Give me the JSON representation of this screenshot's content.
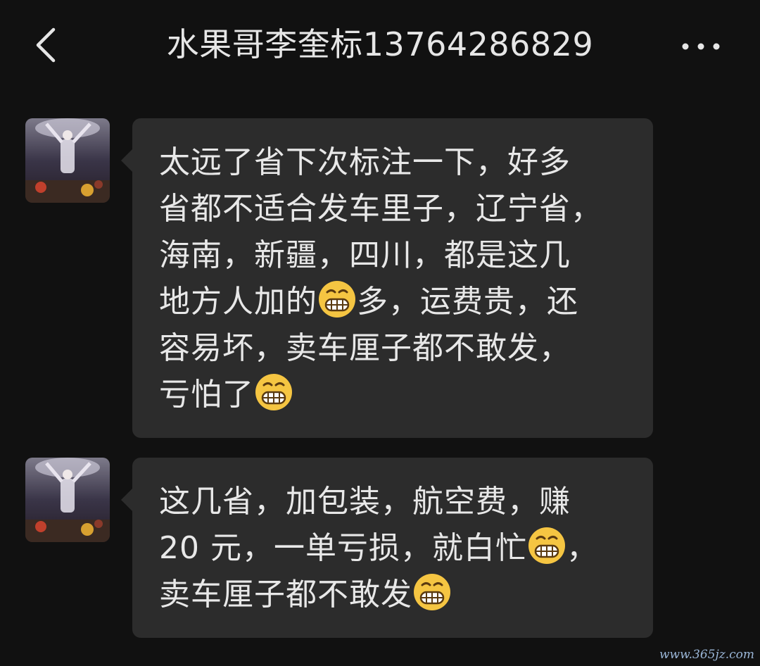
{
  "header": {
    "title": "水果哥李奎标13764286829",
    "back_icon": "chevron-left-icon",
    "more_icon": "more-horizontal-icon"
  },
  "messages": [
    {
      "sender_avatar": "contact-avatar",
      "lines": [
        {
          "text": "太远了省下次标注一下，好多",
          "after_emoji": ""
        },
        {
          "text": "省都不适合发车里子，辽宁省，",
          "after_emoji": ""
        },
        {
          "text": "海南，新疆，四川，都是这几",
          "after_emoji": ""
        },
        {
          "text": "地方人加的",
          "emoji": "grin-emoji",
          "after_emoji": "多，运费贵，还"
        },
        {
          "text": "容易坏，卖车厘子都不敢发，",
          "after_emoji": ""
        },
        {
          "text": "亏怕了",
          "emoji": "grin-emoji",
          "after_emoji": ""
        }
      ]
    },
    {
      "sender_avatar": "contact-avatar",
      "lines": [
        {
          "text": "这几省，加包装，航空费，赚",
          "after_emoji": ""
        },
        {
          "text": "20 元，一单亏损，就白忙",
          "emoji": "grin-emoji",
          "after_emoji": "，"
        },
        {
          "text": "卖车厘子都不敢发",
          "emoji": "grin-emoji",
          "after_emoji": ""
        }
      ]
    }
  ],
  "watermark": "www.365jz.com",
  "colors": {
    "background": "#111111",
    "bubble": "#2c2c2c",
    "text": "#e8e8e8",
    "emoji": "#f5c542"
  }
}
